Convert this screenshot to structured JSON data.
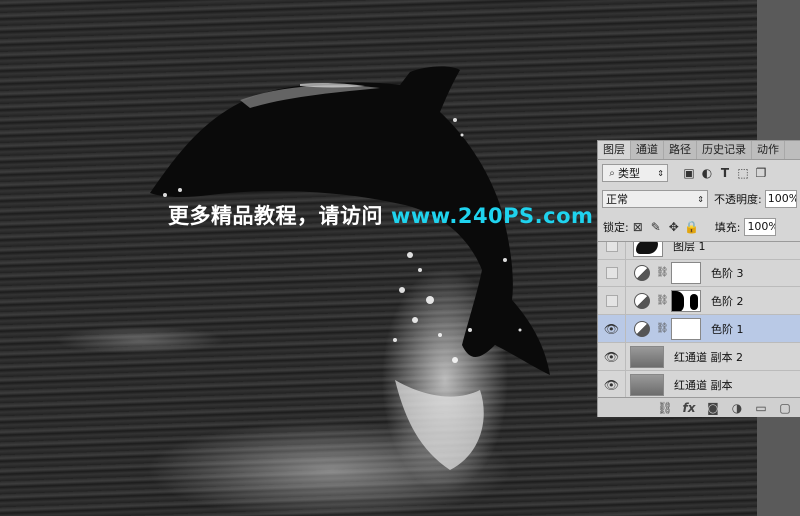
{
  "watermark": {
    "text_cn": "更多精品教程，请访问",
    "url": "www.240PS.com"
  },
  "layers_panel": {
    "tabs": [
      "图层",
      "通道",
      "路径",
      "历史记录",
      "动作"
    ],
    "active_tab": "图层",
    "filter": {
      "kind_label": "类型"
    },
    "blend_mode": "正常",
    "opacity_label": "不透明度:",
    "opacity_value": "100%",
    "lock_label": "锁定:",
    "fill_label": "填充:",
    "fill_value": "100%",
    "layers": [
      {
        "name": "图层 1",
        "visible": false,
        "type": "pixel"
      },
      {
        "name": "色阶 3",
        "visible": false,
        "type": "adjustment"
      },
      {
        "name": "色阶 2",
        "visible": false,
        "type": "adjustment"
      },
      {
        "name": "色阶 1",
        "visible": true,
        "type": "adjustment",
        "selected": true
      },
      {
        "name": "红通道 副本 2",
        "visible": true,
        "type": "pixel"
      },
      {
        "name": "红通道 副本",
        "visible": true,
        "type": "pixel"
      }
    ],
    "bottom_icons": [
      "link-icon",
      "fx-icon",
      "add-mask-icon",
      "new-adjustment-icon",
      "new-group-icon",
      "new-layer-icon"
    ]
  },
  "colors": {
    "watermark_url": "#1fd3ee",
    "selected_layer_bg": "#b9c9e6",
    "panel_bg": "#d6d6d6"
  }
}
